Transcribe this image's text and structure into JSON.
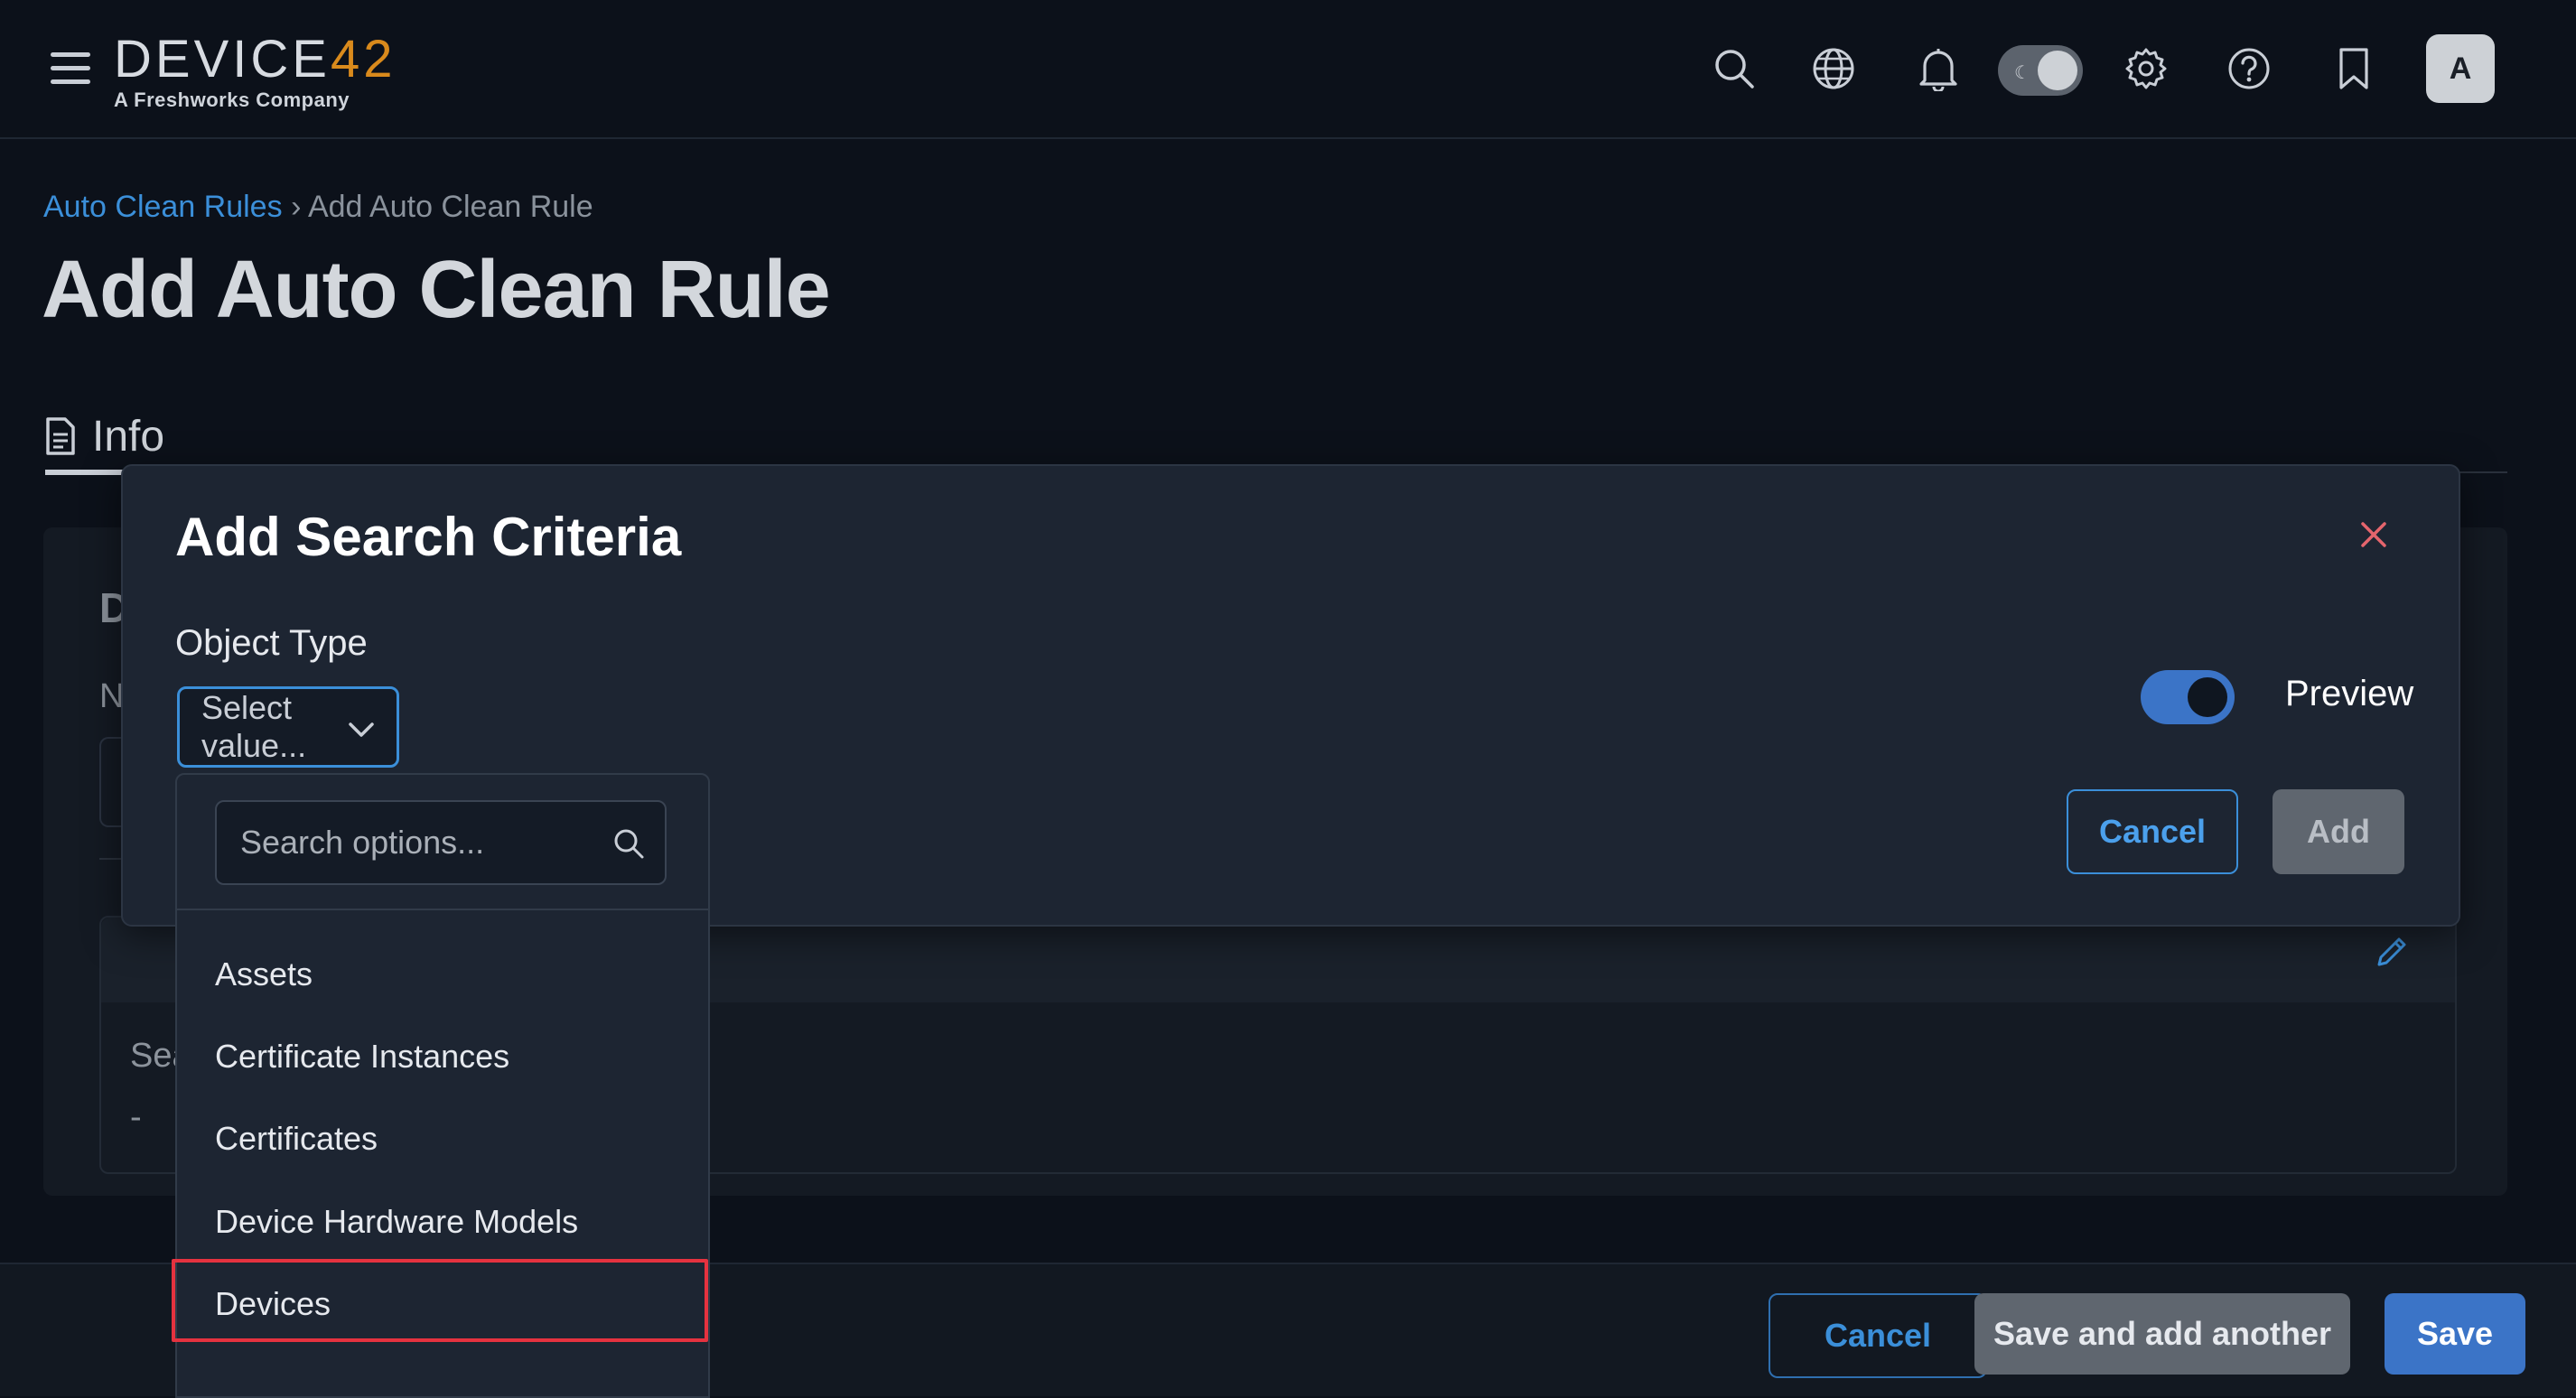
{
  "brand": {
    "logo_text": "DEVICE",
    "logo_num": "42",
    "logo_sub": "A Freshworks Company"
  },
  "header_icons": [
    "search-icon",
    "globe-icon",
    "bell-icon",
    "theme-toggle",
    "gear-icon",
    "help-icon",
    "bookmark-icon"
  ],
  "user": {
    "avatar_initial": "A"
  },
  "breadcrumb": {
    "parent": "Auto Clean Rules",
    "separator": "›",
    "current": "Add Auto Clean Rule"
  },
  "page": {
    "title": "Add Auto Clean Rule",
    "tab_label": "Info"
  },
  "background_fragments": {
    "section_letter": "D",
    "field_letter": "N",
    "search_letter": "Sea",
    "dash": "-"
  },
  "modal": {
    "title": "Add Search Criteria",
    "object_type_label": "Object Type",
    "select_placeholder": "Select value...",
    "preview_label": "Preview",
    "preview_enabled": true,
    "cancel_label": "Cancel",
    "add_label": "Add"
  },
  "dropdown": {
    "search_placeholder": "Search options...",
    "options": [
      "Assets",
      "Certificate Instances",
      "Certificates",
      "Device Hardware Models",
      "Devices"
    ],
    "highlighted_option": "Devices"
  },
  "footer": {
    "cancel_label": "Cancel",
    "save_add_label": "Save and add another",
    "save_label": "Save"
  },
  "colors": {
    "accent": "#3b8fd9",
    "brand_orange": "#d98a1c",
    "highlight": "#e5323f",
    "close": "#e5656d"
  }
}
